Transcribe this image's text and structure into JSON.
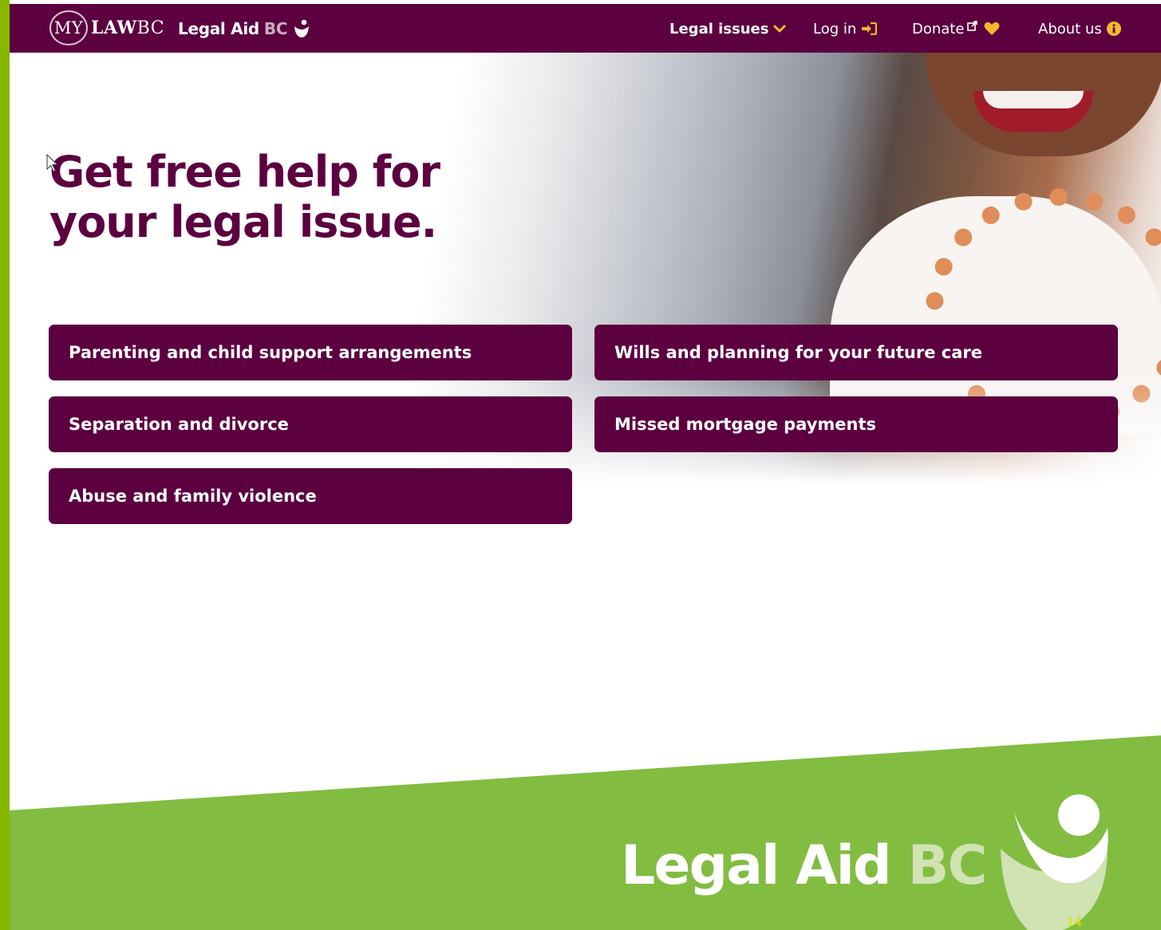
{
  "header": {
    "mylaw_my": "MY",
    "mylaw_law": "LAW",
    "mylaw_bc": "BC",
    "lab_legal_aid": "Legal Aid",
    "lab_bc": "BC",
    "nav": {
      "legal_issues": "Legal issues",
      "login": "Log in",
      "donate": "Donate",
      "about": "About us"
    }
  },
  "hero": {
    "title": "Get free help for your legal issue."
  },
  "topics": [
    "Parenting and child support arrangements",
    "Wills and planning for your future care",
    "Separation and divorce",
    "Missed mortgage payments",
    "Abuse and family violence"
  ],
  "footer": {
    "legal_aid": "Legal Aid",
    "bc": "BC",
    "page_number": "14"
  },
  "colors": {
    "brand_purple": "#5c0040",
    "accent_yellow": "#f5b82e",
    "footer_green": "#82bc41",
    "side_bar_green": "#86b800"
  },
  "icons": {
    "legal_issues": "chevron-down-icon",
    "login": "sign-in-icon",
    "donate_external": "external-link-icon",
    "donate_heart": "heart-icon",
    "about": "info-circle-icon"
  }
}
